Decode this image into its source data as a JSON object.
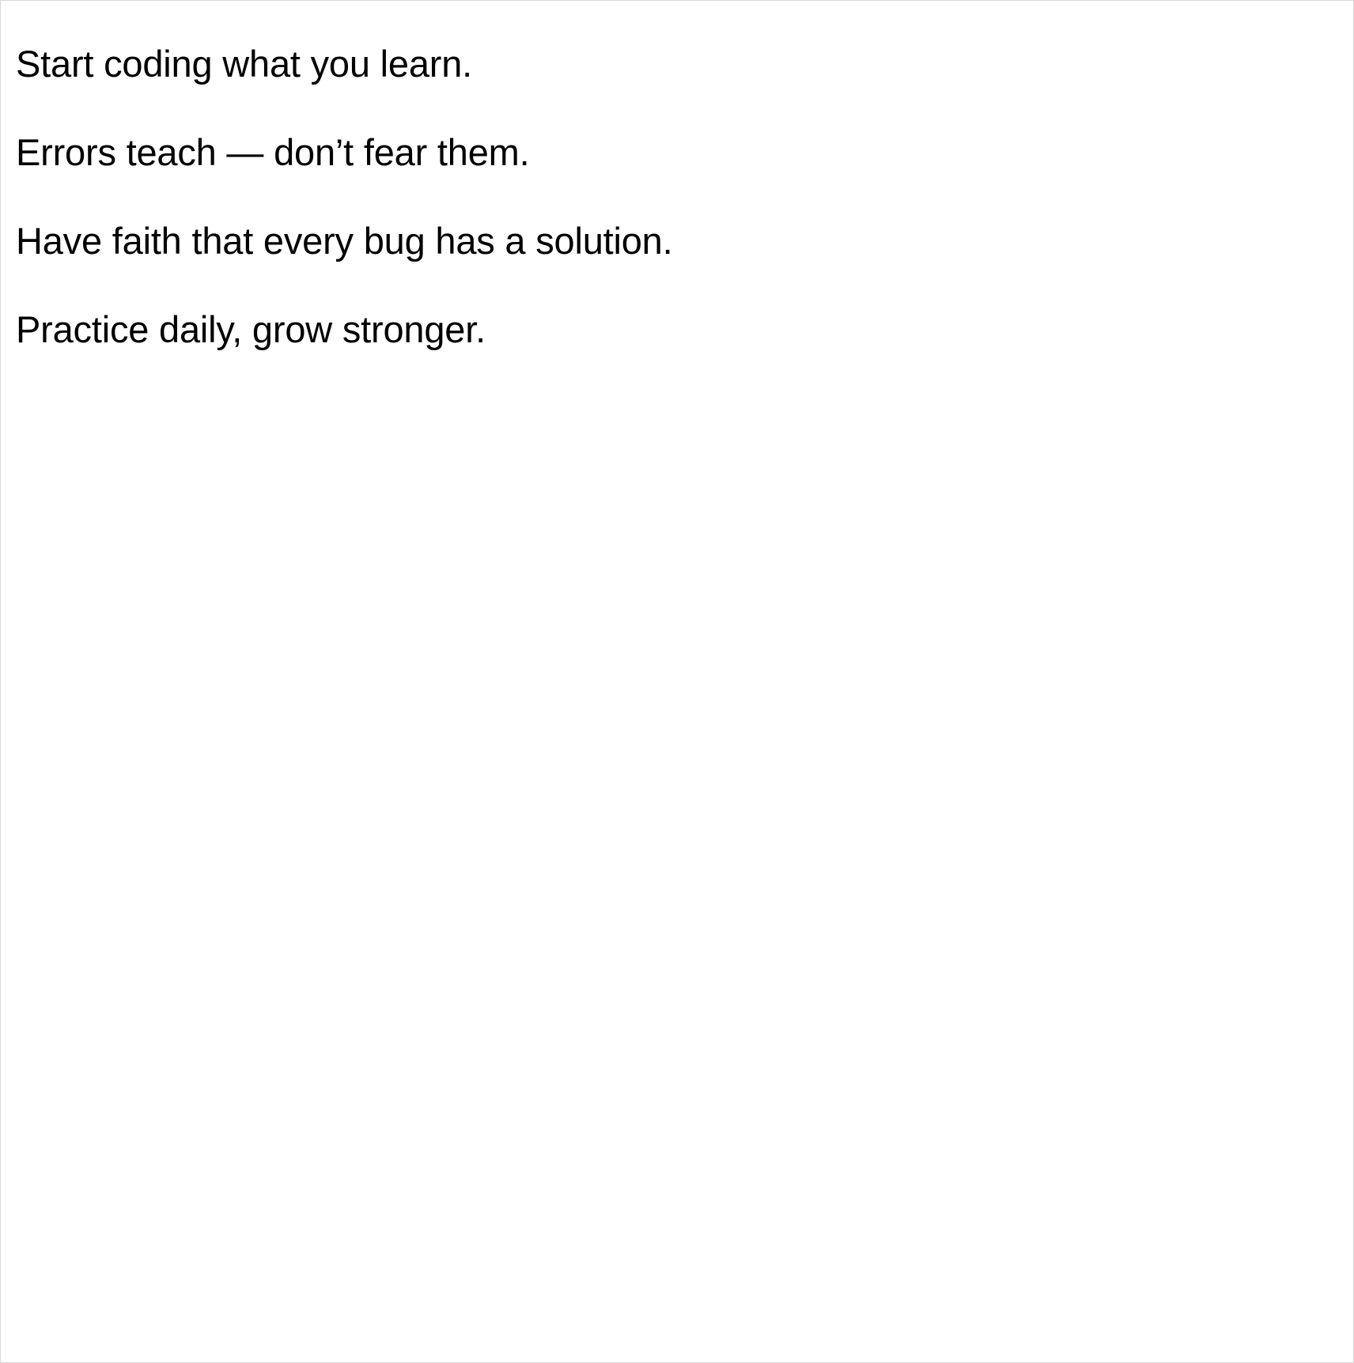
{
  "content": {
    "lines": [
      "Start coding what you learn.",
      "Errors teach — don’t fear them.",
      "Have faith that every bug has a solution.",
      "Practice daily, grow stronger."
    ]
  }
}
